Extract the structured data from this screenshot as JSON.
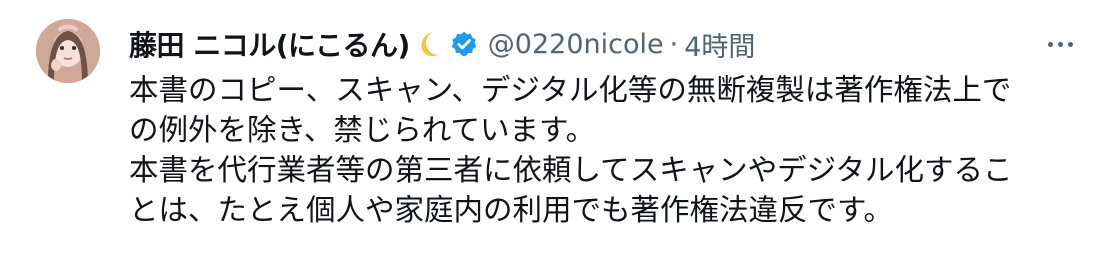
{
  "tweet": {
    "author_name": "藤田 ニコル(にこるん)",
    "handle": "@0220nicole",
    "separator": "·",
    "timestamp": "4時間",
    "icons": {
      "avatar": "profile-avatar",
      "moon": "crescent-moon-emoji",
      "verified": "verified-badge-icon",
      "more": "more-options-icon"
    },
    "colors": {
      "verified_blue": "#1d9bf0",
      "muted_text": "#536471",
      "main_text": "#0f1419"
    },
    "body_lines": [
      "本書のコピー、スキャン、デジタル化等の無断複製は著作権法上で",
      "の例外を除き、禁じられています。",
      "本書を代行業者等の第三者に依頼してスキャンやデジタル化するこ",
      "とは、たとえ個人や家庭内の利用でも著作権法違反です。"
    ]
  }
}
